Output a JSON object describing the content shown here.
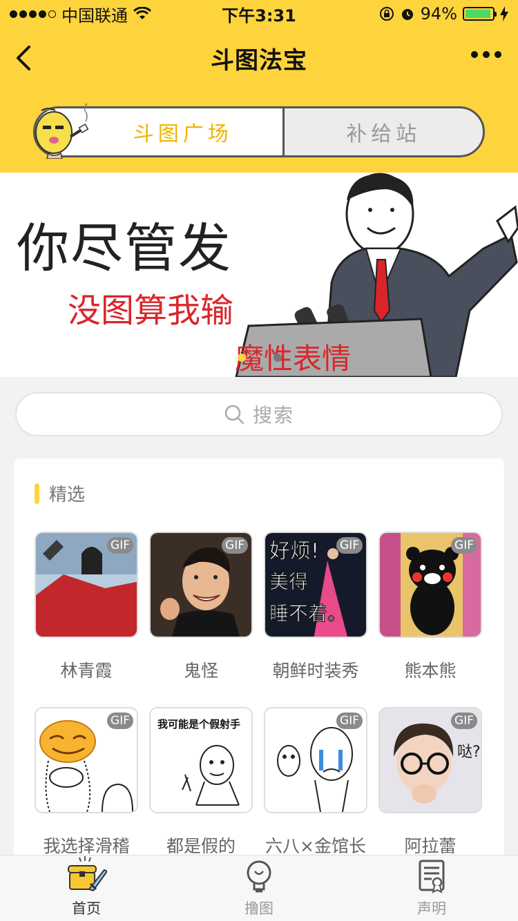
{
  "status_bar": {
    "carrier": "中国联通",
    "time": "下午3:31",
    "battery": "94%",
    "battery_level": 0.94
  },
  "nav": {
    "title": "斗图法宝"
  },
  "segment": {
    "tabs": [
      {
        "label": "斗图广场",
        "active": true
      },
      {
        "label": "补给站",
        "active": false
      }
    ]
  },
  "banner": {
    "headline": "你尽管发",
    "subline": "没图算我输",
    "tag": "魔性表情",
    "page_count": 2,
    "current_page": 1
  },
  "search": {
    "placeholder": "搜索"
  },
  "featured": {
    "title": "精选",
    "badge": "GIF",
    "items": [
      {
        "label": "林青霞"
      },
      {
        "label": "鬼怪"
      },
      {
        "label": "朝鲜时装秀",
        "overlay": "好烦! 美得 睡不着。"
      },
      {
        "label": "熊本熊"
      },
      {
        "label": "我选择滑稽"
      },
      {
        "label": "都是假的",
        "overlay": "我可能是个假射手"
      },
      {
        "label": "六八×金馆长"
      },
      {
        "label": "阿拉蕾",
        "overlay": "哒?"
      }
    ]
  },
  "tabbar": {
    "items": [
      {
        "label": "首页",
        "active": true
      },
      {
        "label": "撸图",
        "active": false
      },
      {
        "label": "声明",
        "active": false
      }
    ]
  },
  "colors": {
    "brand": "#fdd43c",
    "accent": "#f0b400",
    "red": "#d9262c"
  }
}
